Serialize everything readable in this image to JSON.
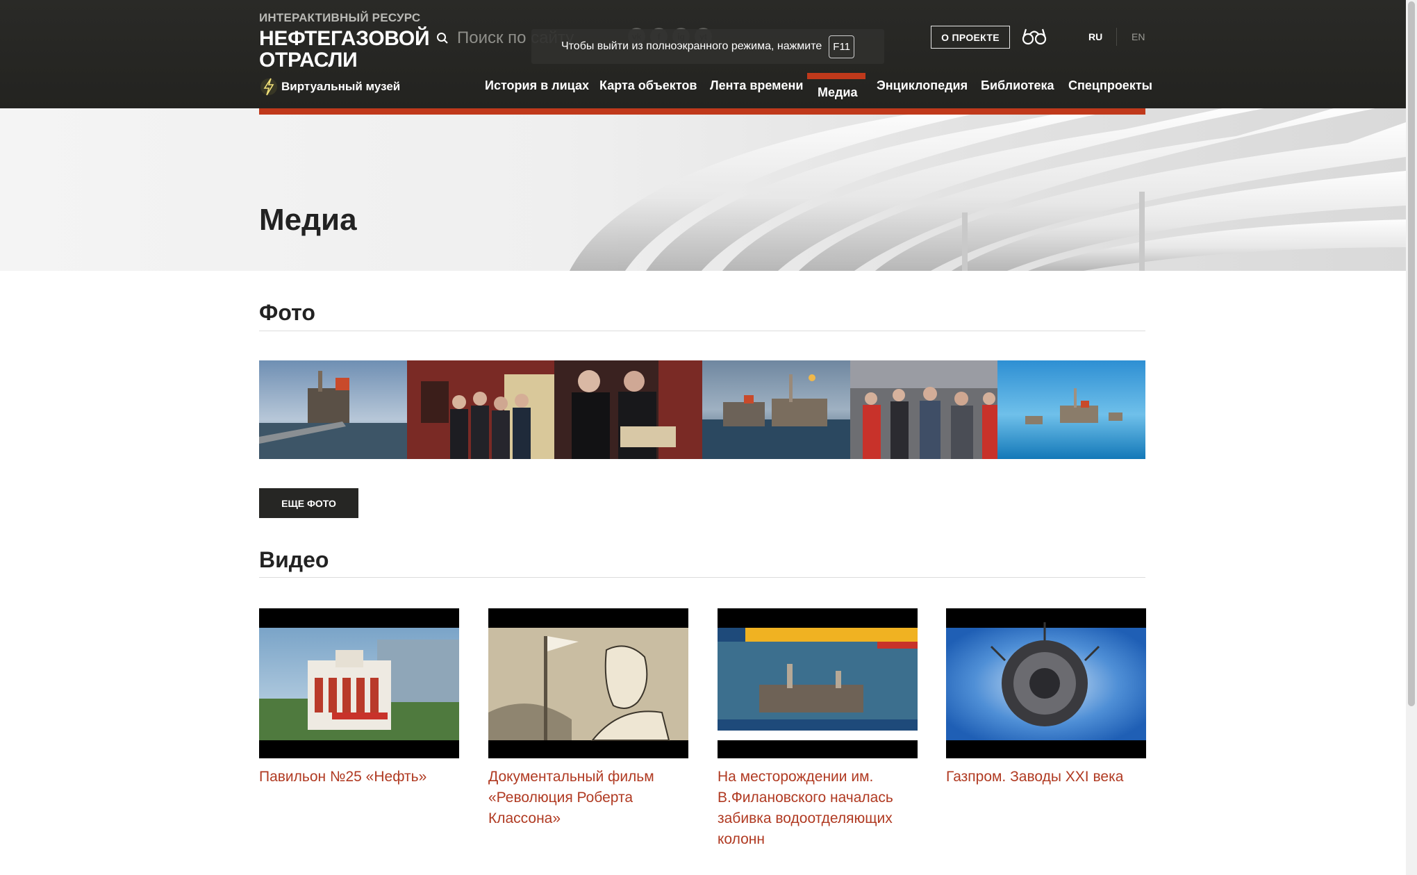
{
  "header": {
    "logo_small": "ИНТЕРАКТИВНЫЙ РЕСУРС",
    "logo_line1": "НЕФТЕГАЗОВОЙ",
    "logo_line2": "ОТРАСЛИ",
    "search_placeholder": "Поиск по сайту",
    "search_icon": "search-icon",
    "fullscreen_notice": "Чтобы выйти из полноэкранного режима, нажмите",
    "fullscreen_key": "F11",
    "about_label": "О ПРОЕКТЕ",
    "accessibility_icon": "glasses-icon",
    "lang_ru": "RU",
    "lang_en": "EN",
    "museum_label": "Виртуальный музей",
    "socials": [
      "vk",
      "f",
      "ig",
      "yt"
    ]
  },
  "nav": [
    {
      "label": "История в лицах",
      "active": false
    },
    {
      "label": "Карта объектов",
      "active": false
    },
    {
      "label": "Лента времени",
      "active": false
    },
    {
      "label": "Медиа",
      "active": true
    },
    {
      "label": "Энциклопедия",
      "active": false
    },
    {
      "label": "Библиотека",
      "active": false
    },
    {
      "label": "Спецпроекты",
      "active": false
    }
  ],
  "page_title": "Медиа",
  "photos": {
    "title": "Фото",
    "more_label": "ЕЩЕ ФОТО"
  },
  "videos": {
    "title": "Видео",
    "items": [
      {
        "title": "Павильон №25 «Нефть»"
      },
      {
        "title": "Документальный фильм «Революция Роберта Классона»"
      },
      {
        "title": "На месторождении им. В.Филановского началась забивка водоотделяющих колонн"
      },
      {
        "title": "Газпром. Заводы XXI века"
      }
    ]
  },
  "colors": {
    "accent": "#c0391b",
    "header_bg": "#2a2a27",
    "link": "#b03a22"
  }
}
